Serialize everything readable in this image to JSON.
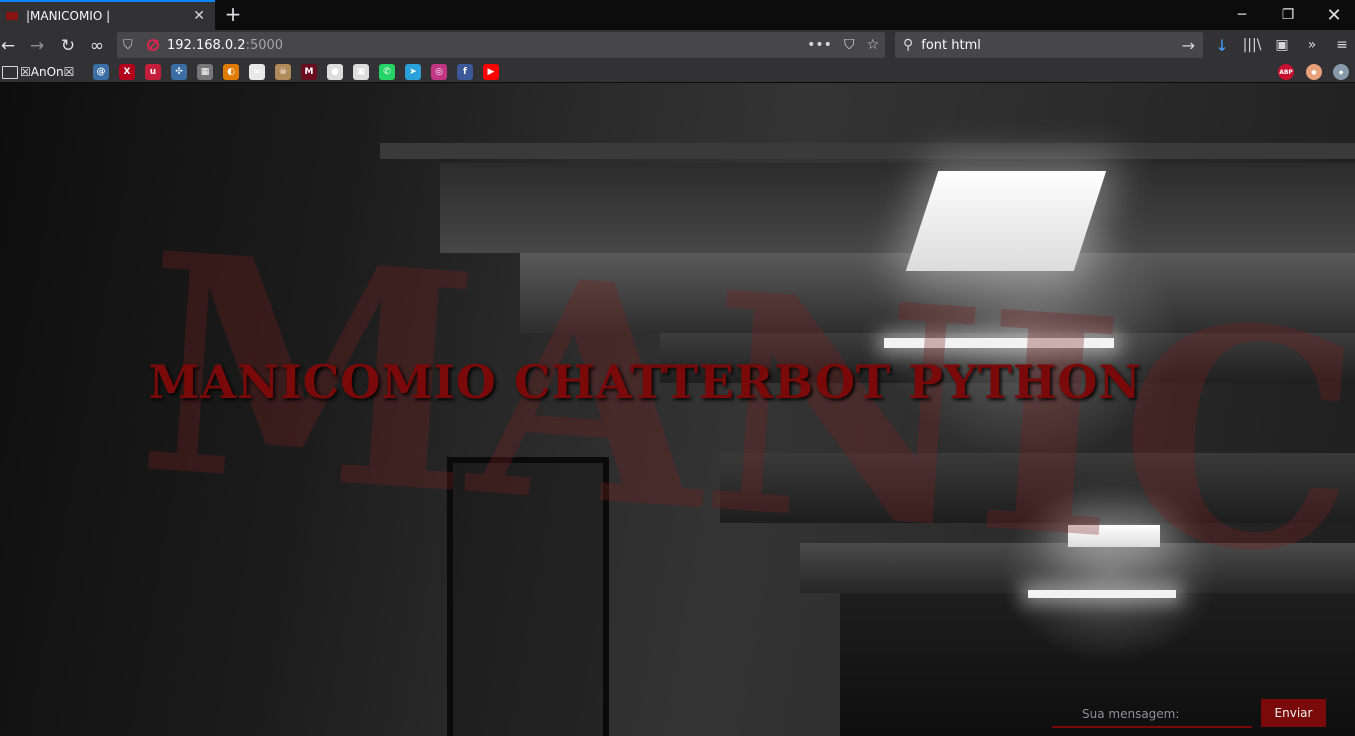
{
  "browser": {
    "tab": {
      "title": "|MANICOMIO |",
      "close": "✕"
    },
    "newtab": "+",
    "window": {
      "minimize": "─",
      "maximize": "❐",
      "close": "✕"
    },
    "nav": {
      "back": "←",
      "forward": "→",
      "reload": "↻",
      "private": "∞"
    },
    "url": {
      "host": "192.168.0.2",
      "port": ":5000",
      "more": "•••",
      "pocket": "⛉",
      "star": "☆"
    },
    "search": {
      "value": "font html",
      "go": "→"
    },
    "tools": {
      "download": "↓",
      "library": "|||\\",
      "sidebar": "▣",
      "overflow": "»",
      "menu": "≡"
    },
    "bookmarks": {
      "folder_label": "☒AnOn☒",
      "items": [
        {
          "icon": "swirl-icon",
          "color": "#3a6ea5",
          "glyph": "@"
        },
        {
          "icon": "x-icon",
          "color": "#b3001b",
          "glyph": "X"
        },
        {
          "icon": "wave-icon",
          "color": "#c41e3a",
          "glyph": "u"
        },
        {
          "icon": "triskelion-icon",
          "color": "#3a6ea5",
          "glyph": "✣"
        },
        {
          "icon": "mask-icon",
          "color": "#777777",
          "glyph": "▦"
        },
        {
          "icon": "ring-icon",
          "color": "#e07b00",
          "glyph": "◐"
        },
        {
          "icon": "glasses-icon",
          "color": "#e8e8e8",
          "glyph": "∞"
        },
        {
          "icon": "skull-icon",
          "color": "#b08a5a",
          "glyph": "☠"
        },
        {
          "icon": "m-icon",
          "color": "#6a0d1f",
          "glyph": "M"
        },
        {
          "icon": "github-icon",
          "color": "#dddddd",
          "glyph": "●"
        },
        {
          "icon": "lock-icon",
          "color": "#dddddd",
          "glyph": "▣"
        },
        {
          "icon": "whatsapp-icon",
          "color": "#25d366",
          "glyph": "✆"
        },
        {
          "icon": "telegram-icon",
          "color": "#2aa1da",
          "glyph": "➤"
        },
        {
          "icon": "instagram-icon",
          "color": "#c13584",
          "glyph": "◎"
        },
        {
          "icon": "facebook-icon",
          "color": "#3b5998",
          "glyph": "f"
        },
        {
          "icon": "youtube-icon",
          "color": "#ff0000",
          "glyph": "▶"
        }
      ],
      "extensions": [
        {
          "icon": "adblock-icon",
          "color": "#c8102e",
          "glyph": "ABP"
        },
        {
          "icon": "bottle-icon",
          "color": "#e8a07a",
          "glyph": "●"
        },
        {
          "icon": "extension-icon",
          "color": "#8899aa",
          "glyph": "◆"
        }
      ]
    }
  },
  "page": {
    "title": "MANICOMIO CHATTERBOT PYTHON",
    "wall_text": "MANICOMIO",
    "input": {
      "placeholder": "Sua mensagem:",
      "value": ""
    },
    "send_label": "Enviar",
    "colors": {
      "accent": "#7a0a0a"
    }
  }
}
